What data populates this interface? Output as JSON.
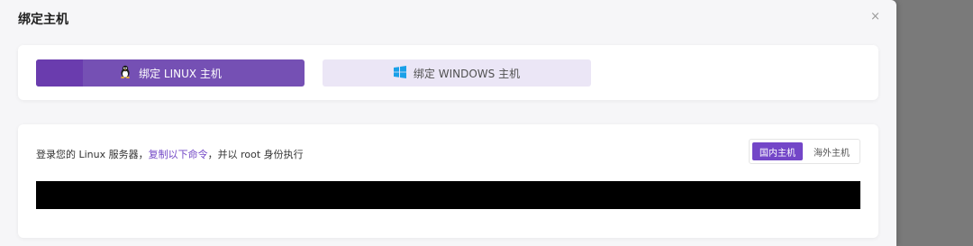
{
  "modal": {
    "title": "绑定主机",
    "close_label": "×"
  },
  "tabs": [
    {
      "label": "绑定 LINUX 主机",
      "icon": "linux-penguin-icon",
      "active": true
    },
    {
      "label": "绑定 WINDOWS 主机",
      "icon": "windows-logo-icon",
      "active": false
    }
  ],
  "instruction": {
    "prefix": "登录您的 Linux 服务器，",
    "link": "复制以下命令",
    "suffix": "，并以 root 身份执行"
  },
  "region_toggle": {
    "options": [
      "国内主机",
      "海外主机"
    ],
    "selected": "国内主机"
  },
  "command": {
    "text": ""
  },
  "colors": {
    "accent": "#7346c8",
    "tab_active_bg": "#7550b4",
    "tab_inactive_bg": "#ebe6f6",
    "windows_blue": "#1aa0e8"
  }
}
